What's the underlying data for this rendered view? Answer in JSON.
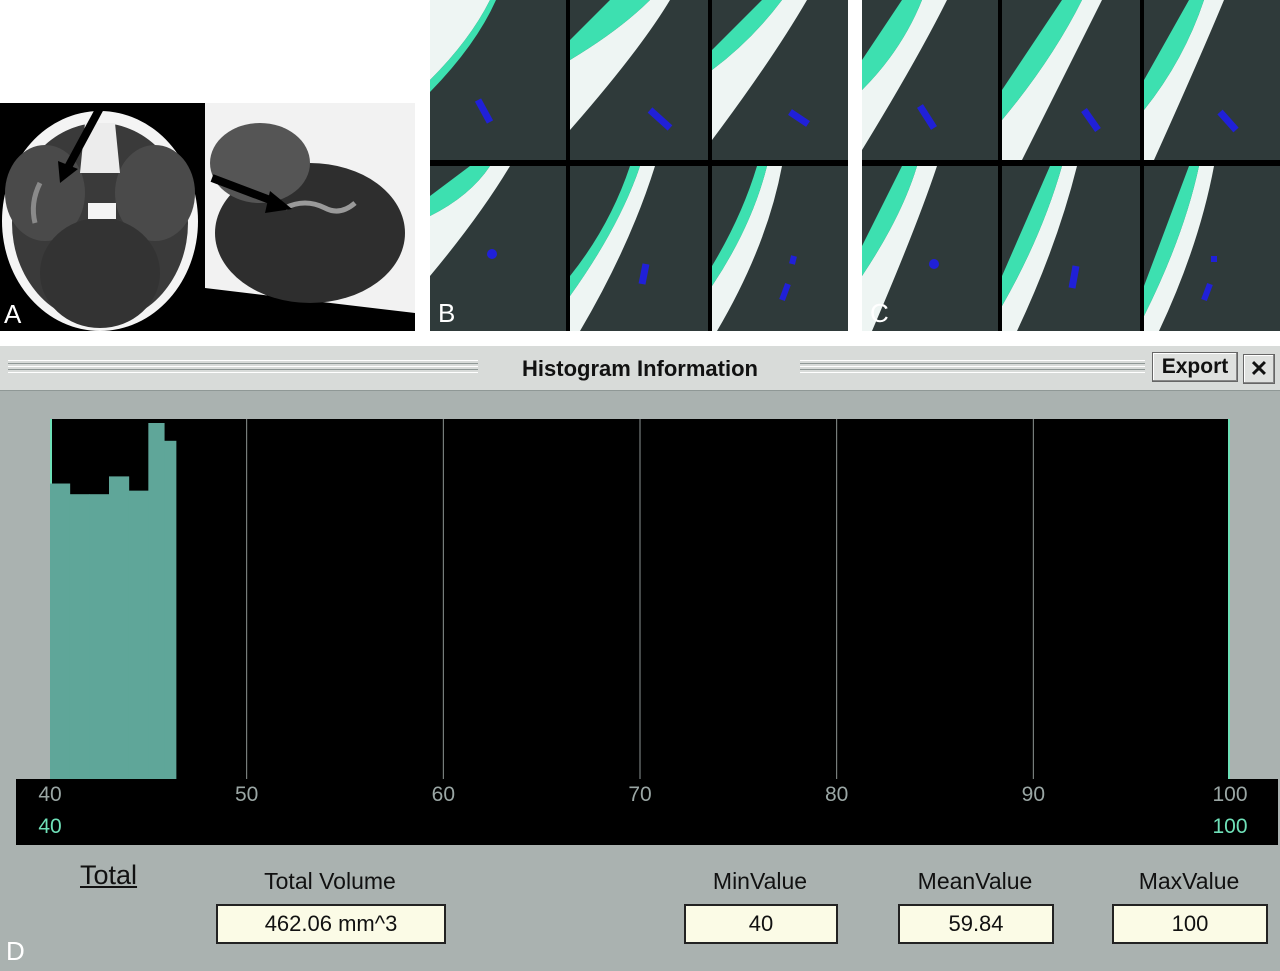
{
  "panel_labels": {
    "a": "A",
    "b": "B",
    "c": "C",
    "d": "D"
  },
  "window": {
    "title": "Histogram Information",
    "export_label": "Export",
    "close_label": "✕"
  },
  "colors": {
    "bar_fill": "#5fa699",
    "accent_green": "#6fe0b8",
    "window_bg": "#aab2b0",
    "vessel_blue": "#2020d8",
    "bone_cyan": "#3de0b0"
  },
  "chart_data": {
    "type": "bar",
    "xlim": [
      40,
      100
    ],
    "x_ticks": [
      40,
      50,
      60,
      70,
      80,
      90,
      100
    ],
    "range_low": 40,
    "range_high": 100,
    "bins": [
      {
        "x0": 40,
        "x1": 41,
        "value": 0.83
      },
      {
        "x0": 41,
        "x1": 42,
        "value": 0.8
      },
      {
        "x0": 42,
        "x1": 43,
        "value": 0.8
      },
      {
        "x0": 43,
        "x1": 44,
        "value": 0.85
      },
      {
        "x0": 44,
        "x1": 45,
        "value": 0.81
      },
      {
        "x0": 45,
        "x1": 45.8,
        "value": 1.0
      },
      {
        "x0": 45.8,
        "x1": 46.4,
        "value": 0.95
      }
    ],
    "ylim": [
      0,
      1
    ],
    "grid": "vertical"
  },
  "stats": {
    "total_link": "Total",
    "total_volume_label": "Total Volume",
    "total_volume_value": "462.06 mm^3",
    "min_label": "MinValue",
    "min_value": "40",
    "mean_label": "MeanValue",
    "mean_value": "59.84",
    "max_label": "MaxValue",
    "max_value": "100"
  }
}
